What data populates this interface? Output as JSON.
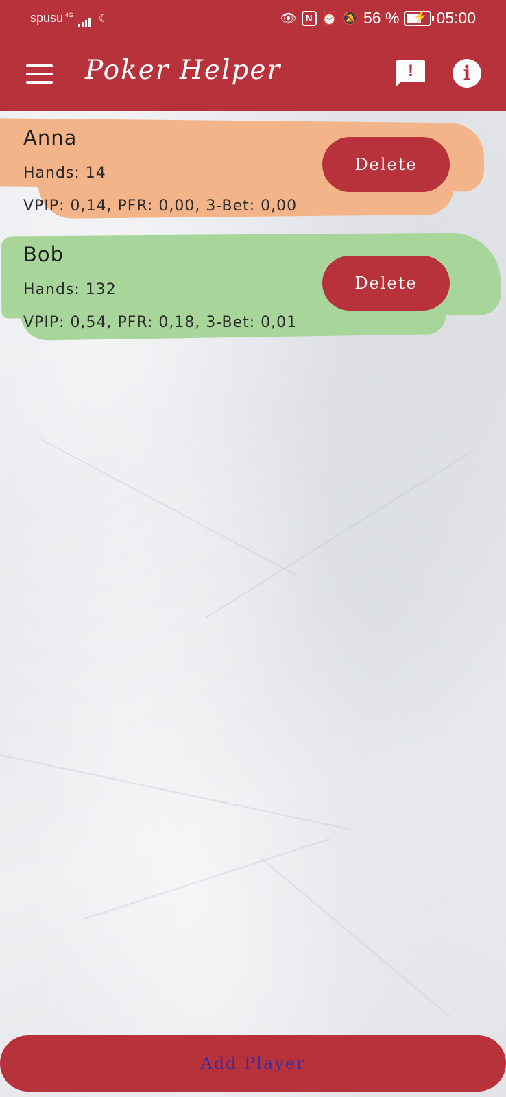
{
  "status_bar": {
    "carrier": "spusu",
    "network": "4G⁺",
    "battery": "56 %",
    "battery_level": 0.56,
    "time": "05:00"
  },
  "app_bar": {
    "title": "Poker Helper",
    "icons": [
      "menu-icon",
      "report-icon",
      "info-icon"
    ]
  },
  "players": [
    {
      "name": "Anna",
      "hands": "Hands: 14",
      "stats": "VPIP: 0,14, PFR: 0,00, 3-Bet: 0,00",
      "delete_label": "Delete",
      "color": "#f3b48a"
    },
    {
      "name": "Bob",
      "hands": "Hands: 132",
      "stats": "VPIP: 0,54, PFR: 0,18, 3-Bet: 0,01",
      "delete_label": "Delete",
      "color": "#a8d59a"
    }
  ],
  "add_player_label": "Add Player",
  "colors": {
    "primary": "#b8323c",
    "add_player_text": "#3a2fa0"
  }
}
